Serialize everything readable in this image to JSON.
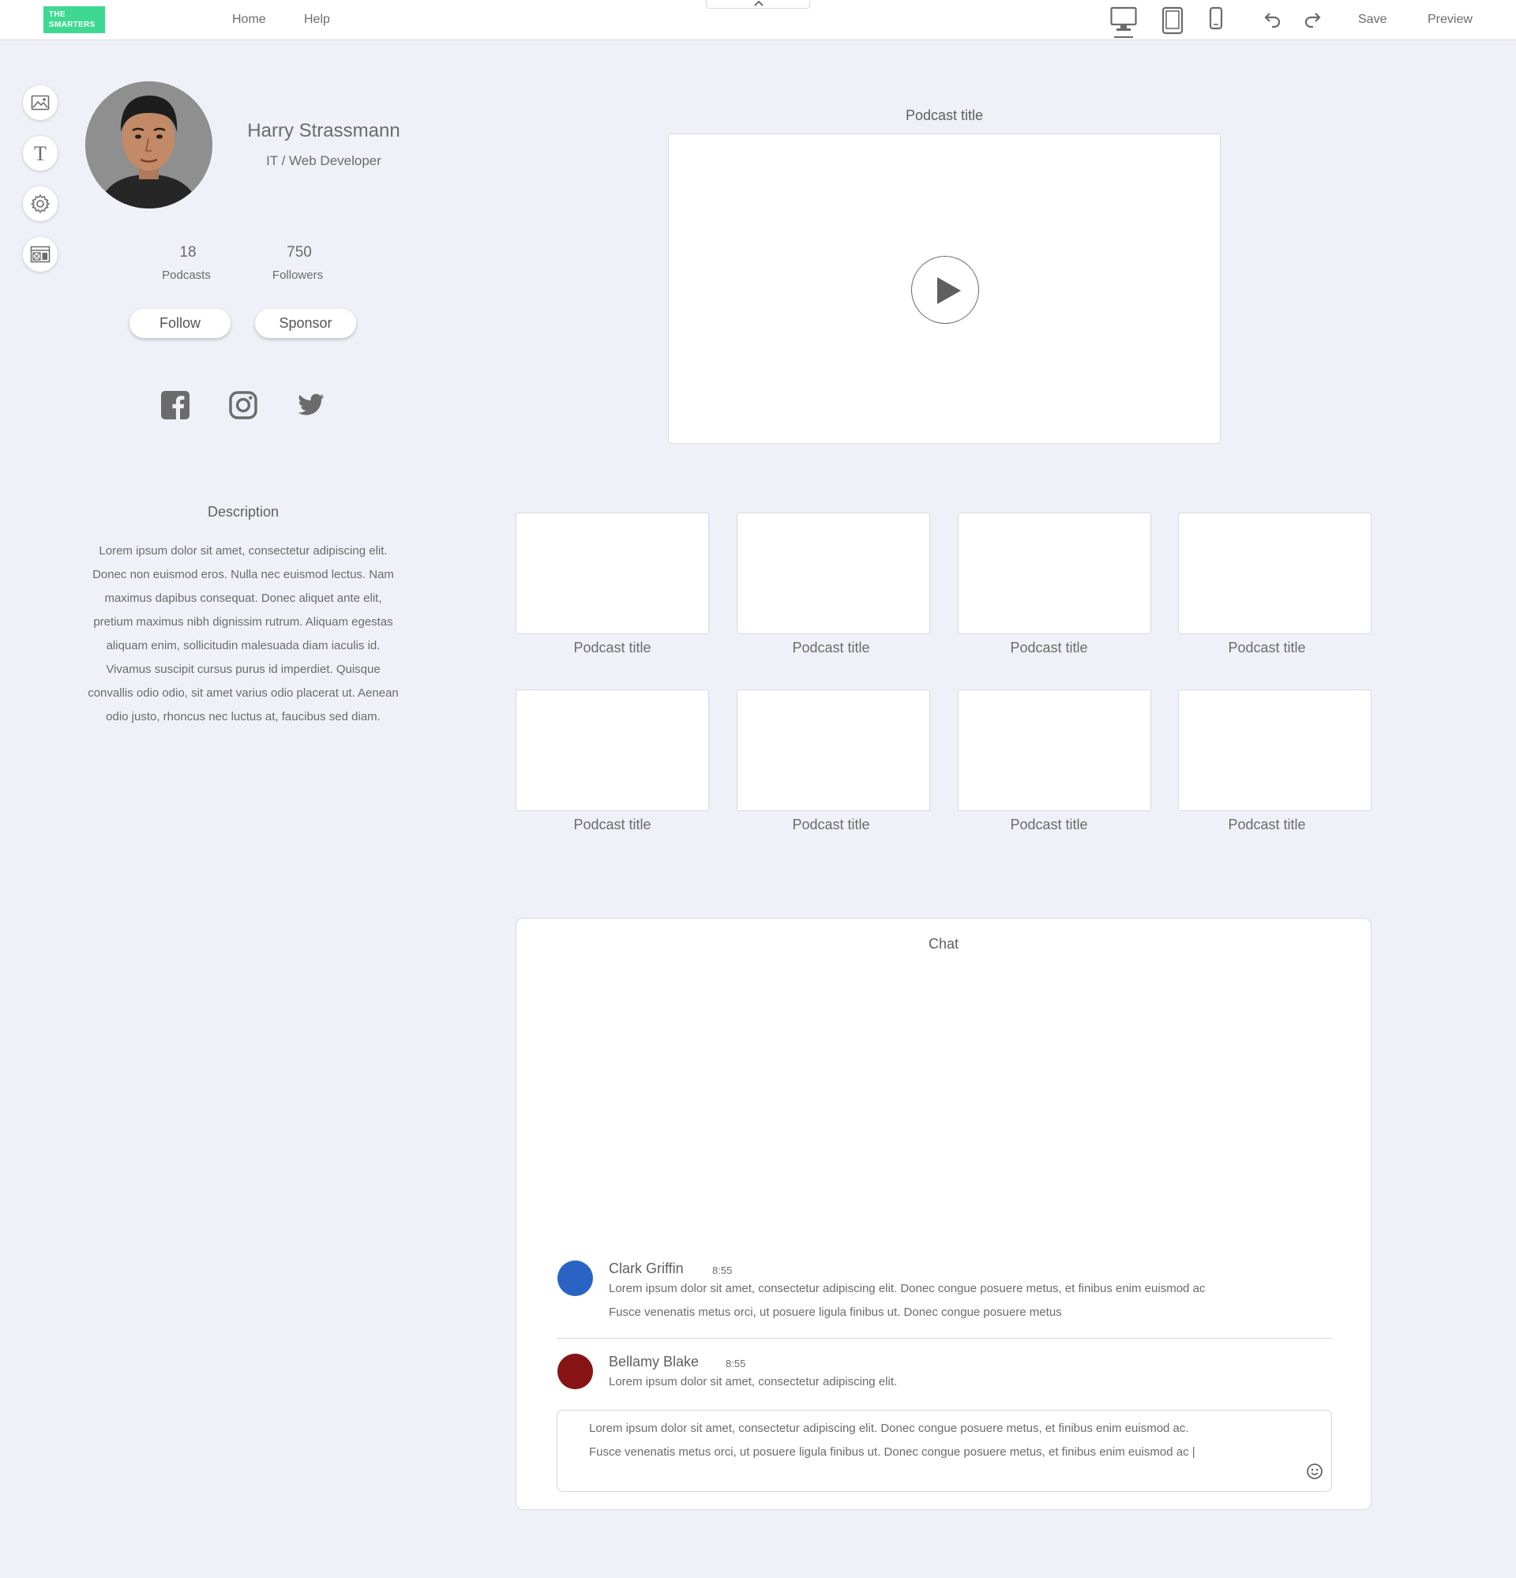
{
  "topbar": {
    "logo_line1": "THE",
    "logo_line2": "SMARTERS",
    "nav": [
      {
        "label": "Home"
      },
      {
        "label": "Help"
      }
    ],
    "save_label": "Save",
    "preview_label": "Preview",
    "devices": [
      "desktop-icon",
      "tablet-icon",
      "mobile-icon"
    ],
    "active_device": "desktop"
  },
  "tools": [
    "image-icon",
    "text-icon",
    "settings-icon",
    "layout-icon"
  ],
  "profile": {
    "name": "Harry Strassmann",
    "role": "IT / Web Developer",
    "stats": [
      {
        "value": "18",
        "label": "Podcasts"
      },
      {
        "value": "750",
        "label": "Followers"
      }
    ],
    "follow_label": "Follow",
    "sponsor_label": "Sponsor",
    "socials": [
      "facebook-icon",
      "instagram-icon",
      "twitter-icon"
    ]
  },
  "description": {
    "title": "Description",
    "text": "Lorem ipsum dolor sit amet, consectetur adipiscing elit. Donec non euismod eros. Nulla nec euismod lectus. Nam maximus dapibus consequat. Donec aliquet ante elit, pretium maximus nibh dignissim rutrum. Aliquam egestas aliquam enim, sollicitudin malesuada diam iaculis id. Vivamus suscipit cursus purus id imperdiet. Quisque convallis odio odio, sit amet varius odio placerat ut. Aenean odio justo, rhoncus nec luctus at, faucibus sed diam."
  },
  "featured": {
    "title": "Podcast title"
  },
  "podcasts": [
    {
      "title": "Podcast title"
    },
    {
      "title": "Podcast title"
    },
    {
      "title": "Podcast title"
    },
    {
      "title": "Podcast title"
    },
    {
      "title": "Podcast title"
    },
    {
      "title": "Podcast title"
    },
    {
      "title": "Podcast title"
    },
    {
      "title": "Podcast title"
    }
  ],
  "chat": {
    "title": "Chat",
    "messages": [
      {
        "name": "Clark Griffin",
        "time": "8:55",
        "color": "#2a63c4",
        "lines": [
          "Lorem ipsum dolor sit amet, consectetur adipiscing elit. Donec congue posuere metus, et finibus enim euismod ac",
          "Fusce venenatis metus orci, ut posuere ligula finibus ut.  Donec congue posuere metus"
        ]
      },
      {
        "name": "Bellamy Blake",
        "time": "8:55",
        "color": "#861414",
        "lines": [
          "Lorem ipsum dolor sit amet, consectetur adipiscing elit."
        ]
      }
    ],
    "draft_lines": [
      "Lorem ipsum dolor sit amet, consectetur adipiscing elit. Donec congue posuere metus, et finibus enim euismod ac.",
      "Fusce venenatis metus orci, ut posuere ligula finibus ut.  Donec congue posuere metus, et finibus enim euismod ac |"
    ]
  },
  "colors": {
    "brand": "#3ed991",
    "background": "#f0f0f8",
    "text": "#6b6b6b"
  }
}
